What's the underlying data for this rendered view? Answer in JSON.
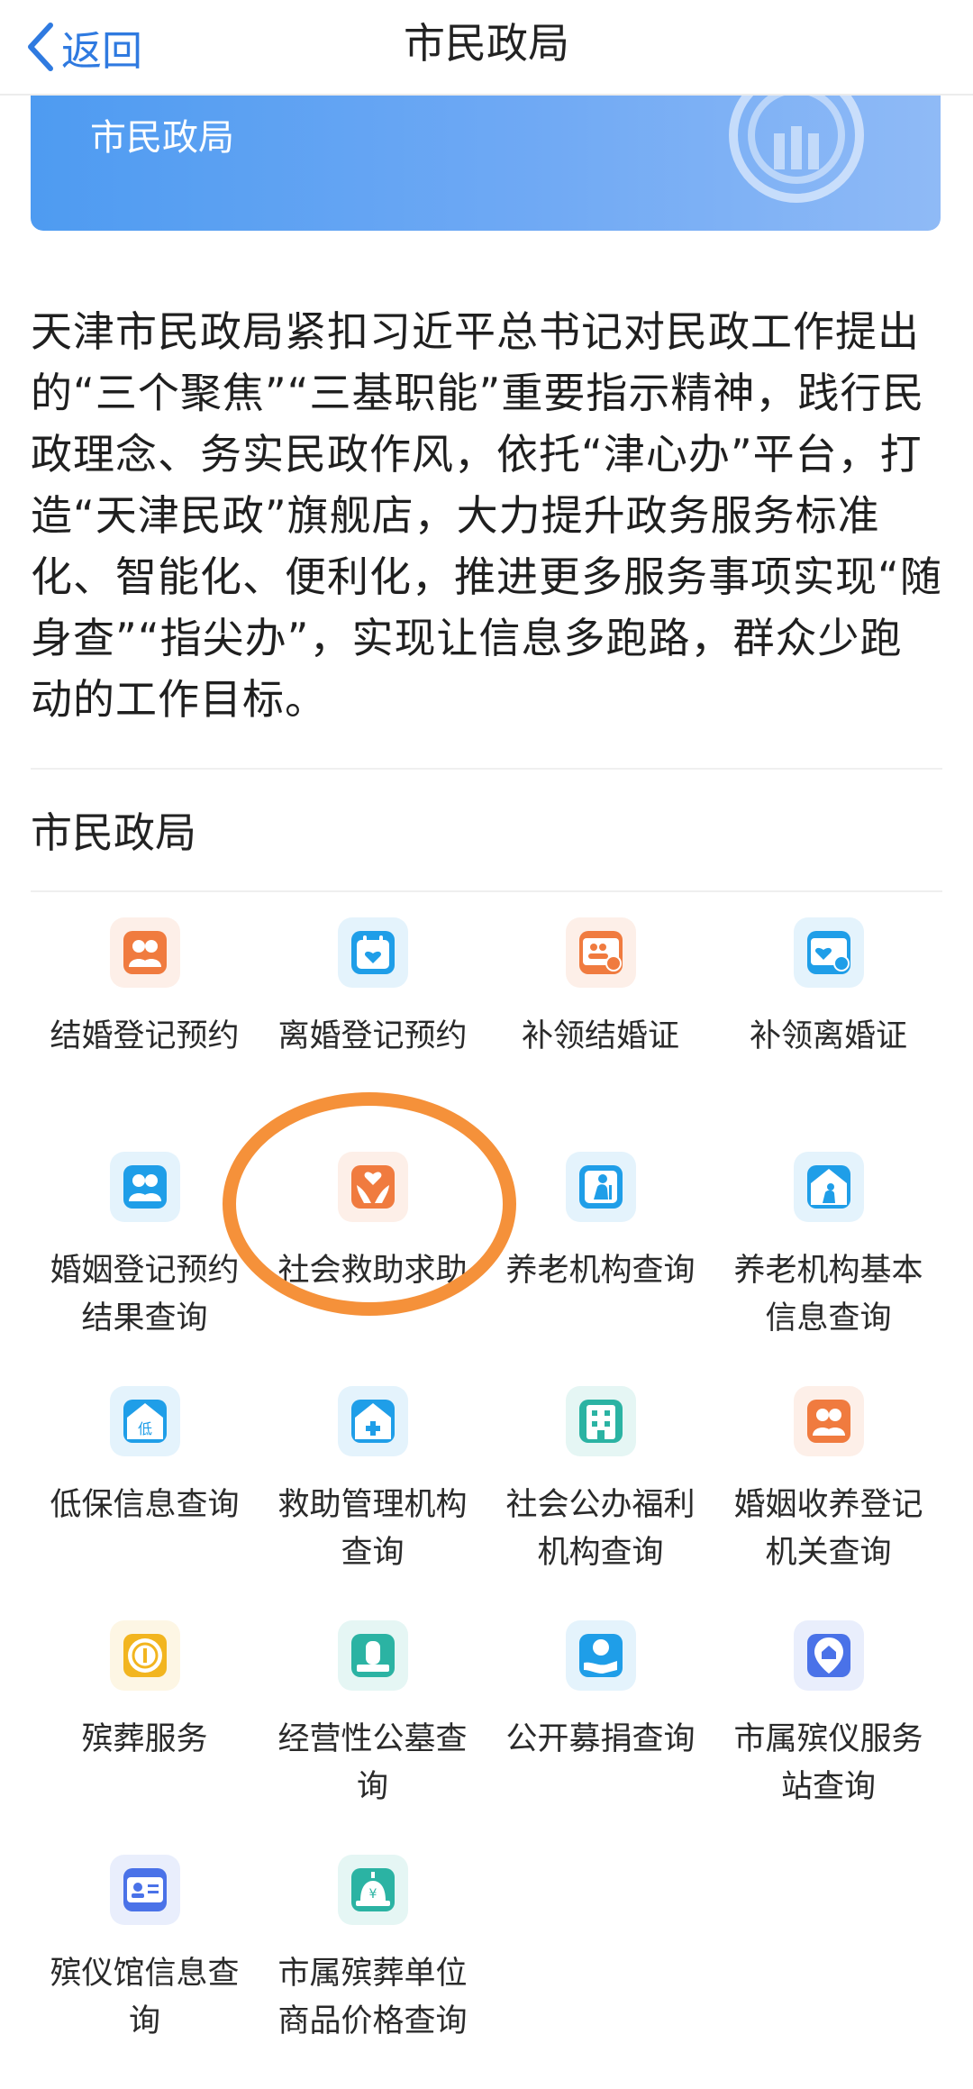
{
  "nav": {
    "back_label": "返回",
    "title": "市民政局"
  },
  "banner": {
    "title": "市民政局"
  },
  "intro_text": "天津市民政局紧扣习近平总书记对民政工作提出的“三个聚焦”“三基职能”重要指示精神，践行民政理念、务实民政作风，依托“津心办”平台，打造“天津民政”旗舰店，大力提升政务服务标准化、智能化、便利化，推进更多服务事项实现“随身查”“指尖办”，实现让信息多跑路，群众少跑动的工作目标。",
  "section": {
    "title": "市民政局"
  },
  "services": [
    {
      "label": "结婚登记预约",
      "icon": "couple-icon",
      "color": "#f07b3f"
    },
    {
      "label": "离婚登记预约",
      "icon": "calendar-heart-icon",
      "color": "#1f9ee8"
    },
    {
      "label": "补领结婚证",
      "icon": "certificate-couple-icon",
      "color": "#f07b3f"
    },
    {
      "label": "补领离婚证",
      "icon": "certificate-heart-icon",
      "color": "#1f9ee8"
    },
    {
      "label": "婚姻登记预约结果查询",
      "icon": "couple-icon",
      "color": "#1f9ee8"
    },
    {
      "label": "社会救助求助",
      "icon": "hands-heart-icon",
      "color": "#f07b3f"
    },
    {
      "label": "养老机构查询",
      "icon": "elder-icon",
      "color": "#1f9ee8"
    },
    {
      "label": "养老机构基本信息查询",
      "icon": "elder-home-icon",
      "color": "#1f9ee8"
    },
    {
      "label": "低保信息查询",
      "icon": "house-low-icon",
      "color": "#1f9ee8"
    },
    {
      "label": "救助管理机构查询",
      "icon": "house-plus-icon",
      "color": "#1f9ee8"
    },
    {
      "label": "社会公办福利机构查询",
      "icon": "building-icon",
      "color": "#2bb3a3"
    },
    {
      "label": "婚姻收养登记机关查询",
      "icon": "couple-icon",
      "color": "#f07b3f"
    },
    {
      "label": "殡葬服务",
      "icon": "coin-icon",
      "color": "#f2b51f"
    },
    {
      "label": "经营性公墓查询",
      "icon": "memorial-icon",
      "color": "#2bb3a3"
    },
    {
      "label": "公开募捐查询",
      "icon": "donation-icon",
      "color": "#1f9ee8"
    },
    {
      "label": "市属殡仪服务站查询",
      "icon": "location-house-icon",
      "color": "#4a72e8"
    },
    {
      "label": "殡仪馆信息查询",
      "icon": "id-card-icon",
      "color": "#4a72e8"
    },
    {
      "label": "市属殡葬单位商品价格查询",
      "icon": "price-alarm-icon",
      "color": "#2bb3a3"
    }
  ]
}
